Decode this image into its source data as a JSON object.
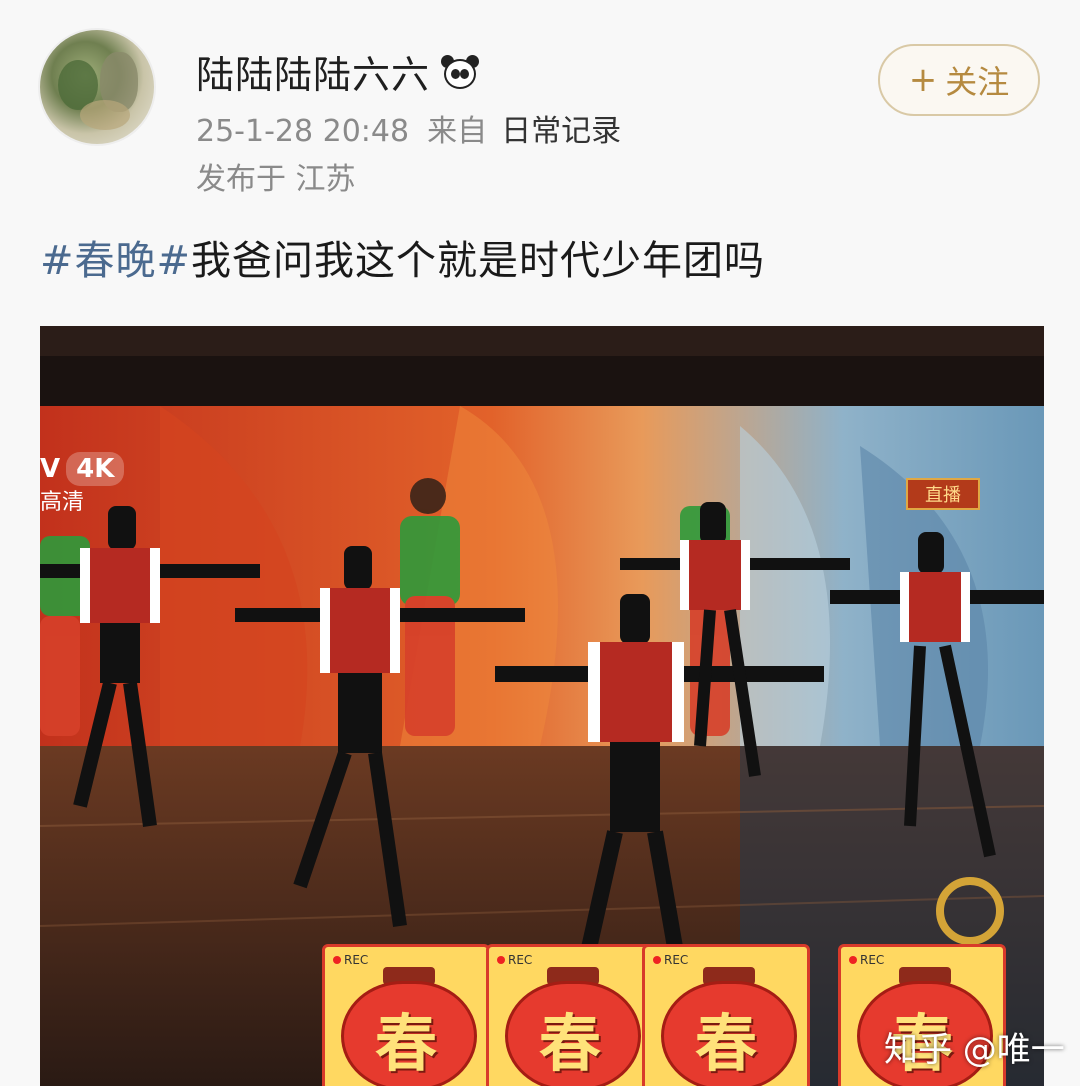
{
  "user": {
    "name": "陆陆陆陆六六",
    "badge_icon": "panda-icon"
  },
  "post_meta": {
    "datetime": "25-1-28 20:48",
    "from_label": "来自",
    "source": "日常记录",
    "location": "发布于 江苏"
  },
  "follow": {
    "icon": "plus-icon",
    "label": "关注"
  },
  "post": {
    "hashtag": "#春晚#",
    "text": "我爸问我这个就是时代少年团吗"
  },
  "photo_overlay": {
    "channel_badge": "V",
    "quality": "4K",
    "hd_label": "高清",
    "live_label": "直播"
  },
  "stickers": [
    {
      "rec": "REC",
      "char": "春"
    },
    {
      "rec": "REC",
      "char": "春"
    },
    {
      "rec": "REC",
      "char": "春"
    },
    {
      "rec": "REC",
      "char": "春"
    }
  ],
  "watermark": "知乎 @唯一",
  "colors": {
    "hashtag": "#4b6a8f",
    "follow_text": "#b58a40",
    "follow_border": "#d9c9a6",
    "meta_gray": "#8a8a8a"
  }
}
